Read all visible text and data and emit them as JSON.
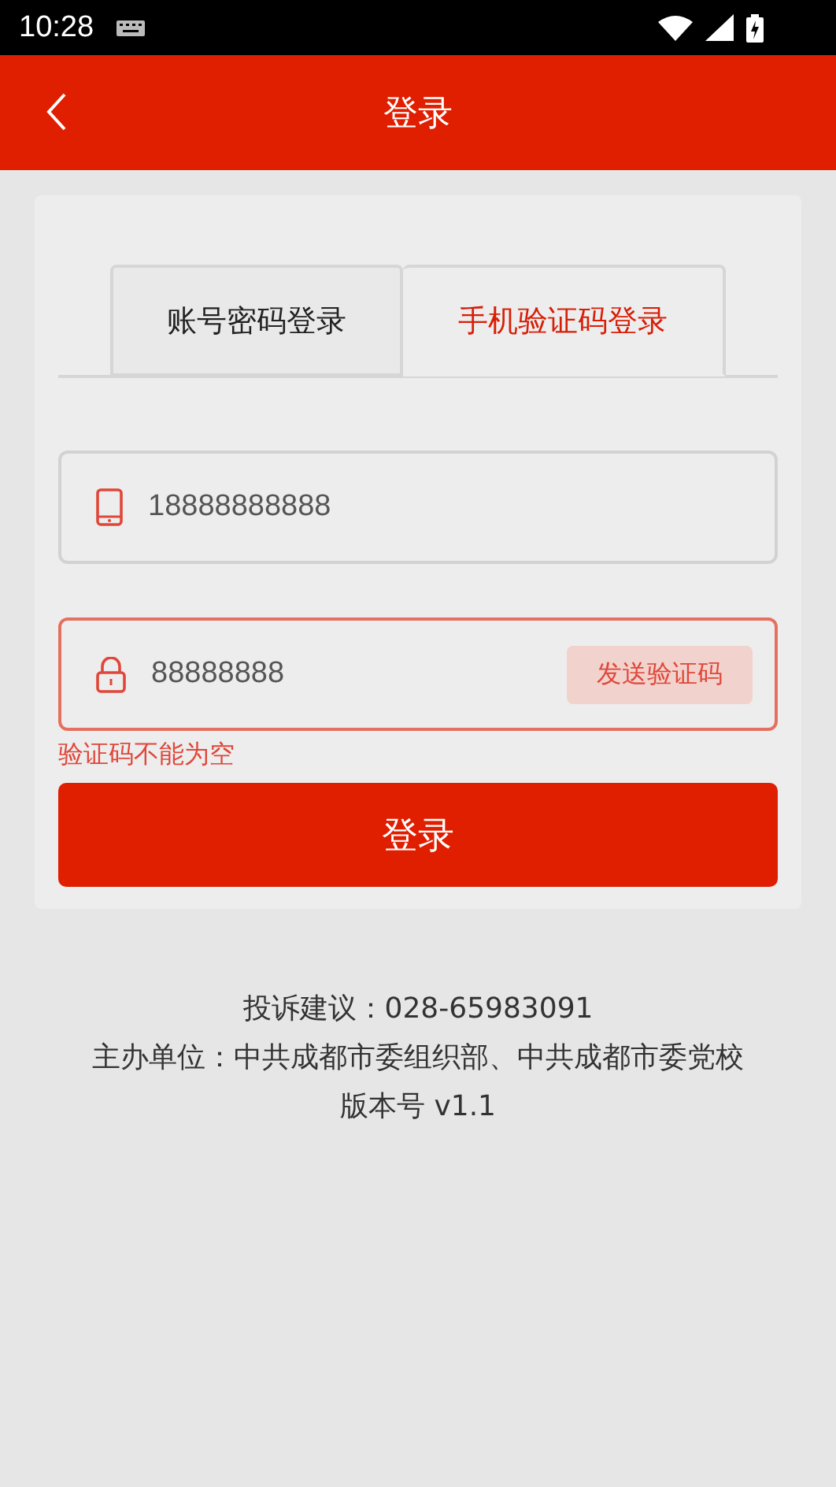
{
  "status_bar": {
    "time": "10:28"
  },
  "header": {
    "title": "登录"
  },
  "tabs": [
    {
      "label": "账号密码登录",
      "selected": false
    },
    {
      "label": "手机验证码登录",
      "selected": true
    }
  ],
  "fields": [
    {
      "kind": "phone",
      "value": "18888888888",
      "error": false
    },
    {
      "kind": "code",
      "value": "88888888",
      "error": true,
      "button": "发送验证码"
    }
  ],
  "error_message": "验证码不能为空",
  "submit": "登录",
  "footer": [
    "投诉建议：028-65983091",
    "主办单位：中共成都市委组织部、中共成都市委党校",
    "版本号 v1.1"
  ]
}
